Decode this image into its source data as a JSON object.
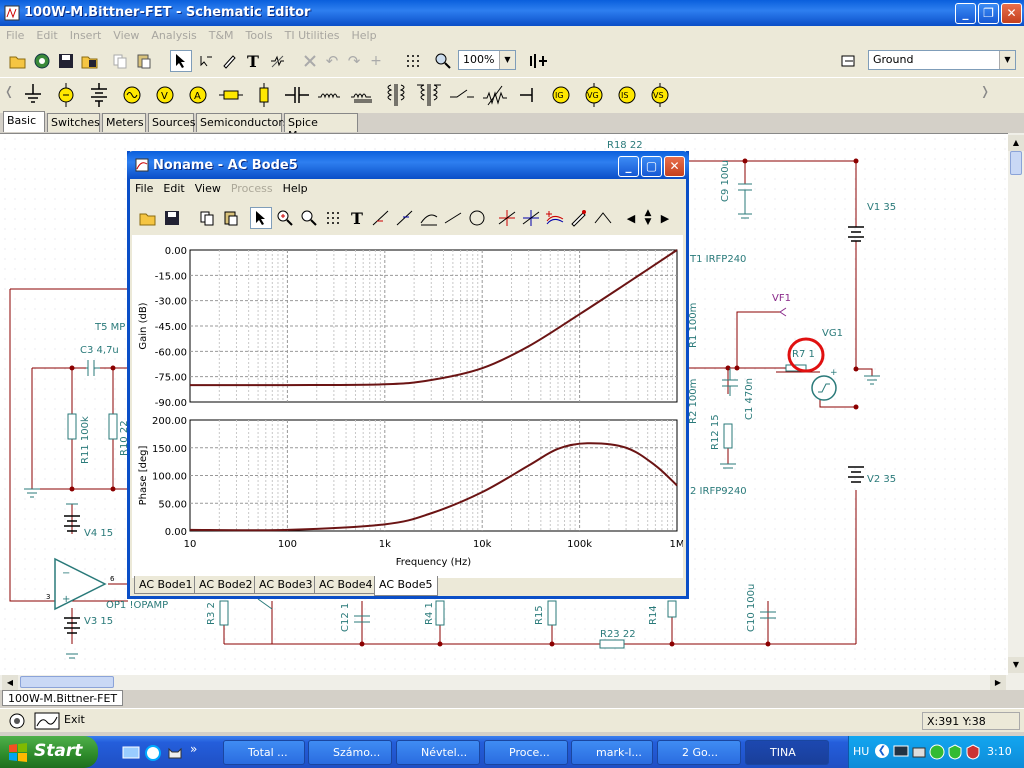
{
  "app": {
    "title": "100W-M.Bittner-FET - Schematic Editor",
    "menu": [
      "File",
      "Edit",
      "Insert",
      "View",
      "Analysis",
      "T&M",
      "Tools",
      "TI Utilities",
      "Help"
    ],
    "zoom": "100%",
    "ground_combo": "Ground",
    "component_tabs": [
      "Basic",
      "Switches",
      "Meters",
      "Sources",
      "Semiconductors",
      "Spice Macros"
    ],
    "active_tab": "Basic",
    "sheet_tab": "100W-M.Bittner-FET",
    "status_coords": "X:391  Y:38",
    "exit_label": "Exit"
  },
  "schematic_labels": {
    "r18": "R18 22",
    "c9": "C9 100u",
    "v1": "V1 35",
    "t1": "T1 IRFP240",
    "vf1": "VF1",
    "vg1": "VG1",
    "r7": "R7 1",
    "r1": "R1 100m",
    "r2": "R2 100m",
    "c1": "C1 470n",
    "r12": "R12 15",
    "v2": "V2 35",
    "t2": "2 IRFP9240",
    "t5": "T5 MP",
    "c3": "C3 4,7u",
    "r11": "R11 100k",
    "r10": "R10 22",
    "v4": "V4 15",
    "v3": "V3 15",
    "op1": "OP1 !OPAMP",
    "r3": "R3 2",
    "c12": "C12 1",
    "r4": "R4 1",
    "r15": "R15",
    "r14": "R14",
    "r23": "R23 22",
    "c10": "C10 100u"
  },
  "bode": {
    "title": "Noname - AC Bode5",
    "menu": [
      "File",
      "Edit",
      "View",
      "Process",
      "Help"
    ],
    "menu_disabled": [
      "Process"
    ],
    "tabs": [
      "AC Bode1",
      "AC Bode2",
      "AC Bode3",
      "AC Bode4",
      "AC Bode5"
    ],
    "active_tab": "AC Bode5"
  },
  "chart_data": [
    {
      "type": "line",
      "ylabel": "Gain (dB)",
      "xscale": "log",
      "xlim": [
        10,
        1000000
      ],
      "ylim": [
        -90,
        0
      ],
      "yticks": [
        "0.00",
        "-15.00",
        "-30.00",
        "-45.00",
        "-60.00",
        "-75.00",
        "-90.00"
      ],
      "grid": true,
      "color": "#6b1414",
      "x": [
        10,
        100,
        1000,
        3000,
        10000,
        30000,
        100000,
        300000,
        1000000
      ],
      "y": [
        -80,
        -80,
        -79.5,
        -77,
        -70,
        -57,
        -38,
        -20,
        0
      ]
    },
    {
      "type": "line",
      "ylabel": "Phase [deg]",
      "xlabel": "Frequency (Hz)",
      "xscale": "log",
      "xlim": [
        10,
        1000000
      ],
      "ylim": [
        0,
        200
      ],
      "yticks": [
        "200.00",
        "150.00",
        "100.00",
        "50.00",
        "0.00"
      ],
      "xticks": [
        "10",
        "100",
        "1k",
        "10k",
        "100k",
        "1M"
      ],
      "grid": true,
      "color": "#6b1414",
      "x": [
        10,
        100,
        1000,
        3000,
        10000,
        30000,
        60000,
        120000,
        300000,
        600000,
        1000000
      ],
      "y": [
        2,
        2,
        12,
        32,
        70,
        118,
        148,
        158,
        150,
        118,
        82
      ]
    }
  ],
  "taskbar": {
    "start": "Start",
    "tasks": [
      "Total ...",
      "Számo...",
      "Névtel...",
      "Proce...",
      "mark-l...",
      "2 Go...",
      "TINA"
    ],
    "active": "TINA",
    "lang": "HU",
    "clock": "3:10"
  },
  "colors": {
    "accent": "#0a5fdc",
    "wire": "#8b0000",
    "label": "#2a7a7a",
    "plot_line": "#6b1414"
  }
}
